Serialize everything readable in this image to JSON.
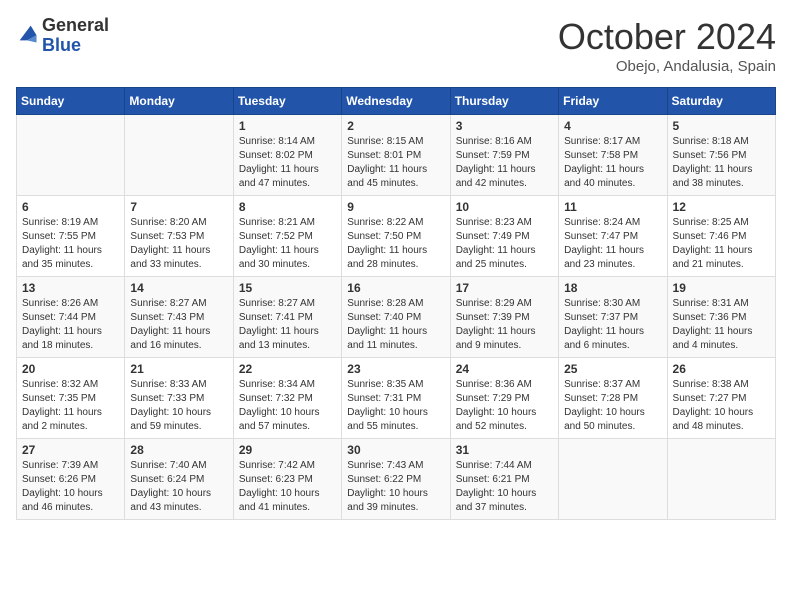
{
  "header": {
    "logo_line1": "General",
    "logo_line2": "Blue",
    "month": "October 2024",
    "location": "Obejo, Andalusia, Spain"
  },
  "days_of_week": [
    "Sunday",
    "Monday",
    "Tuesday",
    "Wednesday",
    "Thursday",
    "Friday",
    "Saturday"
  ],
  "weeks": [
    [
      {
        "day": "",
        "info": ""
      },
      {
        "day": "",
        "info": ""
      },
      {
        "day": "1",
        "info": "Sunrise: 8:14 AM\nSunset: 8:02 PM\nDaylight: 11 hours and 47 minutes."
      },
      {
        "day": "2",
        "info": "Sunrise: 8:15 AM\nSunset: 8:01 PM\nDaylight: 11 hours and 45 minutes."
      },
      {
        "day": "3",
        "info": "Sunrise: 8:16 AM\nSunset: 7:59 PM\nDaylight: 11 hours and 42 minutes."
      },
      {
        "day": "4",
        "info": "Sunrise: 8:17 AM\nSunset: 7:58 PM\nDaylight: 11 hours and 40 minutes."
      },
      {
        "day": "5",
        "info": "Sunrise: 8:18 AM\nSunset: 7:56 PM\nDaylight: 11 hours and 38 minutes."
      }
    ],
    [
      {
        "day": "6",
        "info": "Sunrise: 8:19 AM\nSunset: 7:55 PM\nDaylight: 11 hours and 35 minutes."
      },
      {
        "day": "7",
        "info": "Sunrise: 8:20 AM\nSunset: 7:53 PM\nDaylight: 11 hours and 33 minutes."
      },
      {
        "day": "8",
        "info": "Sunrise: 8:21 AM\nSunset: 7:52 PM\nDaylight: 11 hours and 30 minutes."
      },
      {
        "day": "9",
        "info": "Sunrise: 8:22 AM\nSunset: 7:50 PM\nDaylight: 11 hours and 28 minutes."
      },
      {
        "day": "10",
        "info": "Sunrise: 8:23 AM\nSunset: 7:49 PM\nDaylight: 11 hours and 25 minutes."
      },
      {
        "day": "11",
        "info": "Sunrise: 8:24 AM\nSunset: 7:47 PM\nDaylight: 11 hours and 23 minutes."
      },
      {
        "day": "12",
        "info": "Sunrise: 8:25 AM\nSunset: 7:46 PM\nDaylight: 11 hours and 21 minutes."
      }
    ],
    [
      {
        "day": "13",
        "info": "Sunrise: 8:26 AM\nSunset: 7:44 PM\nDaylight: 11 hours and 18 minutes."
      },
      {
        "day": "14",
        "info": "Sunrise: 8:27 AM\nSunset: 7:43 PM\nDaylight: 11 hours and 16 minutes."
      },
      {
        "day": "15",
        "info": "Sunrise: 8:27 AM\nSunset: 7:41 PM\nDaylight: 11 hours and 13 minutes."
      },
      {
        "day": "16",
        "info": "Sunrise: 8:28 AM\nSunset: 7:40 PM\nDaylight: 11 hours and 11 minutes."
      },
      {
        "day": "17",
        "info": "Sunrise: 8:29 AM\nSunset: 7:39 PM\nDaylight: 11 hours and 9 minutes."
      },
      {
        "day": "18",
        "info": "Sunrise: 8:30 AM\nSunset: 7:37 PM\nDaylight: 11 hours and 6 minutes."
      },
      {
        "day": "19",
        "info": "Sunrise: 8:31 AM\nSunset: 7:36 PM\nDaylight: 11 hours and 4 minutes."
      }
    ],
    [
      {
        "day": "20",
        "info": "Sunrise: 8:32 AM\nSunset: 7:35 PM\nDaylight: 11 hours and 2 minutes."
      },
      {
        "day": "21",
        "info": "Sunrise: 8:33 AM\nSunset: 7:33 PM\nDaylight: 10 hours and 59 minutes."
      },
      {
        "day": "22",
        "info": "Sunrise: 8:34 AM\nSunset: 7:32 PM\nDaylight: 10 hours and 57 minutes."
      },
      {
        "day": "23",
        "info": "Sunrise: 8:35 AM\nSunset: 7:31 PM\nDaylight: 10 hours and 55 minutes."
      },
      {
        "day": "24",
        "info": "Sunrise: 8:36 AM\nSunset: 7:29 PM\nDaylight: 10 hours and 52 minutes."
      },
      {
        "day": "25",
        "info": "Sunrise: 8:37 AM\nSunset: 7:28 PM\nDaylight: 10 hours and 50 minutes."
      },
      {
        "day": "26",
        "info": "Sunrise: 8:38 AM\nSunset: 7:27 PM\nDaylight: 10 hours and 48 minutes."
      }
    ],
    [
      {
        "day": "27",
        "info": "Sunrise: 7:39 AM\nSunset: 6:26 PM\nDaylight: 10 hours and 46 minutes."
      },
      {
        "day": "28",
        "info": "Sunrise: 7:40 AM\nSunset: 6:24 PM\nDaylight: 10 hours and 43 minutes."
      },
      {
        "day": "29",
        "info": "Sunrise: 7:42 AM\nSunset: 6:23 PM\nDaylight: 10 hours and 41 minutes."
      },
      {
        "day": "30",
        "info": "Sunrise: 7:43 AM\nSunset: 6:22 PM\nDaylight: 10 hours and 39 minutes."
      },
      {
        "day": "31",
        "info": "Sunrise: 7:44 AM\nSunset: 6:21 PM\nDaylight: 10 hours and 37 minutes."
      },
      {
        "day": "",
        "info": ""
      },
      {
        "day": "",
        "info": ""
      }
    ]
  ]
}
